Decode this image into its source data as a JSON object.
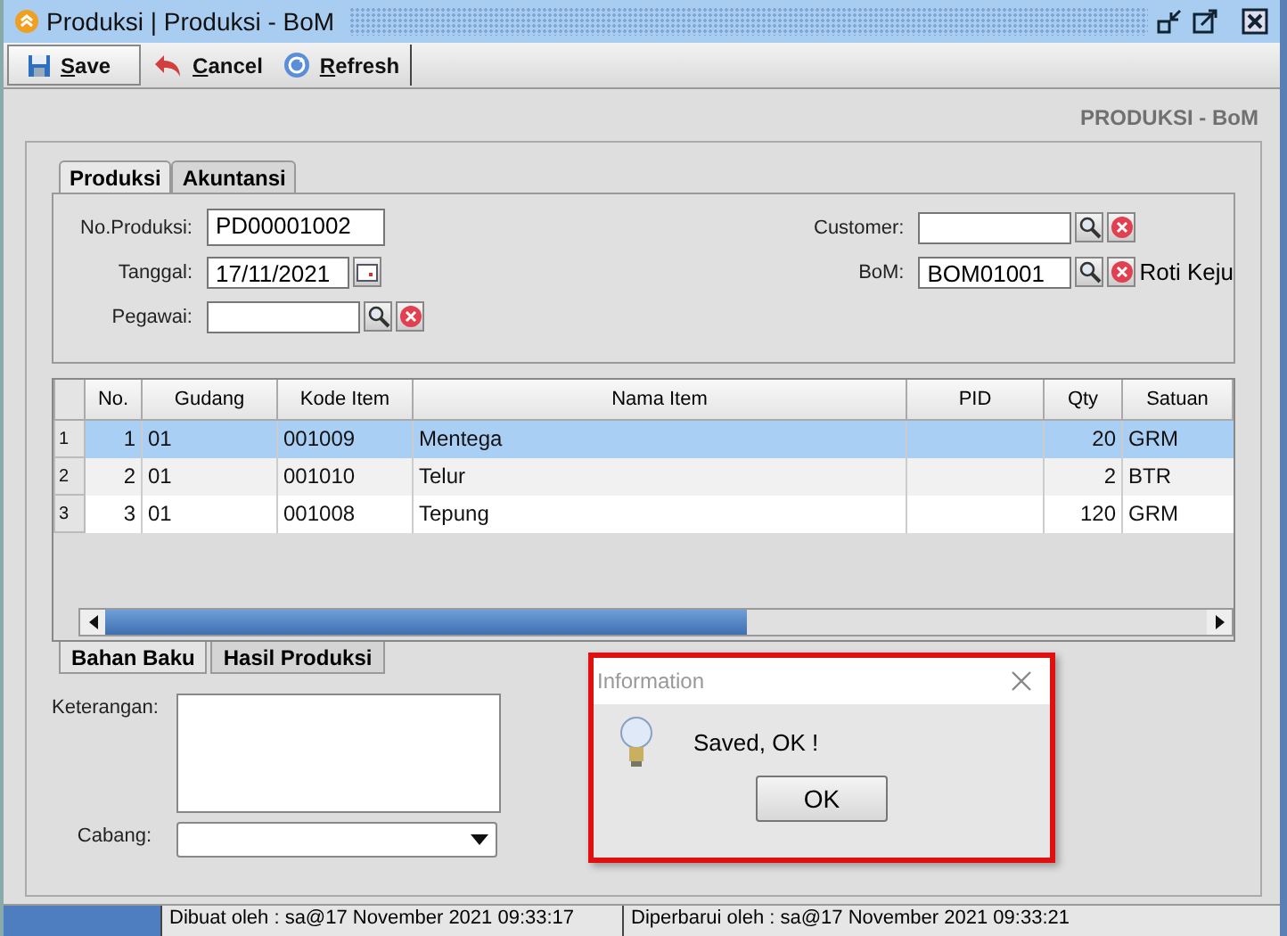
{
  "window": {
    "title": "Produksi | Produksi - BoM"
  },
  "toolbar": [
    {
      "kind": "save",
      "label": "Save"
    },
    {
      "kind": "cancel",
      "label": "Cancel"
    },
    {
      "kind": "refresh",
      "label": "Refresh"
    }
  ],
  "header_title": "PRODUKSI - BoM",
  "tabs": [
    {
      "label": "Produksi",
      "selected": true
    },
    {
      "label": "Akuntansi",
      "selected": false
    }
  ],
  "form_left": [
    {
      "kind": "text",
      "label": "No.Produksi:",
      "value": "PD00001002"
    },
    {
      "kind": "date",
      "label": "Tanggal:",
      "value": "17/11/2021"
    },
    {
      "kind": "lookup",
      "label": "Pegawai:"
    }
  ],
  "form_right": [
    {
      "kind": "lookup",
      "label": "Customer:"
    },
    {
      "kind": "lookup",
      "label": "BoM:",
      "value": "BOM01001",
      "note": "Roti Keju"
    }
  ],
  "table": {
    "columns": [
      {
        "label": "No.",
        "kind": "number"
      },
      {
        "label": "Gudang",
        "kind": "text"
      },
      {
        "label": "Kode Item",
        "kind": "text"
      },
      {
        "label": "Nama Item",
        "kind": "text"
      },
      {
        "label": "PID",
        "kind": "text"
      },
      {
        "label": "Qty",
        "kind": "number"
      },
      {
        "label": "Satuan",
        "kind": "text"
      }
    ],
    "rows": [
      {
        "index": "1",
        "selected": true,
        "cells": [
          "1",
          "01",
          "001009",
          "Mentega",
          "",
          "20",
          "GRM"
        ]
      },
      {
        "index": "2",
        "selected": false,
        "cells": [
          "2",
          "01",
          "001010",
          "Telur",
          "",
          "2",
          "BTR"
        ]
      },
      {
        "index": "3",
        "selected": false,
        "cells": [
          "3",
          "01",
          "001008",
          "Tepung",
          "",
          "120",
          "GRM"
        ]
      }
    ]
  },
  "bottom_tabs": [
    {
      "label": "Bahan Baku",
      "selected": true
    },
    {
      "label": "Hasil Produksi",
      "selected": false
    }
  ],
  "keterangan": {
    "label": "Keterangan:"
  },
  "cabang": {
    "label": "Cabang:"
  },
  "status_bar": [
    "Dibuat oleh : sa@17 November 2021  09:33:17",
    "Diperbarui oleh : sa@17 November 2021  09:33:21"
  ],
  "dialog": {
    "title": "Information",
    "message": "Saved, OK !",
    "button": "OK"
  }
}
